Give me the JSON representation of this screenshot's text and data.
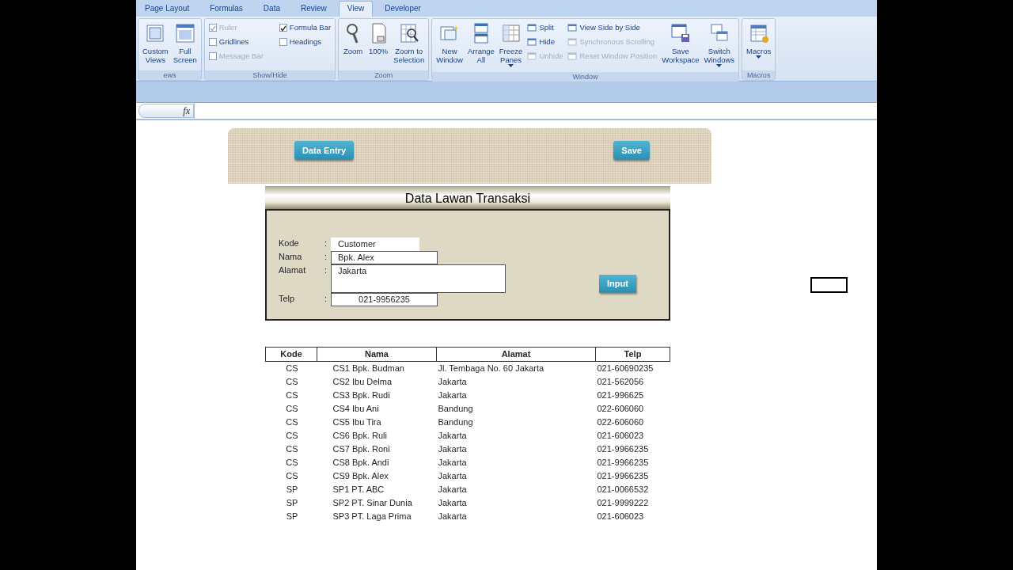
{
  "ribbon_tabs": [
    {
      "label": "Page Layout",
      "selected": false
    },
    {
      "label": "Formulas",
      "selected": false
    },
    {
      "label": "Data",
      "selected": false
    },
    {
      "label": "Review",
      "selected": false
    },
    {
      "label": "View",
      "selected": true
    },
    {
      "label": "Developer",
      "selected": false
    }
  ],
  "ribbon_groups": [
    {
      "label": "ews",
      "items": [
        {
          "kind": "large",
          "lines": [
            "Custom",
            "Views"
          ],
          "disabled": false
        },
        {
          "kind": "large",
          "lines": [
            "Full",
            "Screen"
          ],
          "disabled": false
        }
      ]
    },
    {
      "label": "Show/Hide",
      "columns": [
        [
          {
            "kind": "check",
            "label": "Ruler",
            "checked": true,
            "disabled": true
          },
          {
            "kind": "check",
            "label": "Gridlines",
            "checked": false,
            "disabled": false
          },
          {
            "kind": "check",
            "label": "Message Bar",
            "checked": false,
            "disabled": true
          }
        ],
        [
          {
            "kind": "check",
            "label": "Formula Bar",
            "checked": true,
            "disabled": false
          },
          {
            "kind": "check",
            "label": "Headings",
            "checked": false,
            "disabled": false
          }
        ]
      ]
    },
    {
      "label": "Zoom",
      "items": [
        {
          "kind": "large",
          "lines": [
            "Zoom"
          ],
          "disabled": false
        },
        {
          "kind": "large",
          "lines": [
            "100%"
          ],
          "disabled": false
        },
        {
          "kind": "large",
          "lines": [
            "Zoom to",
            "Selection"
          ],
          "disabled": false
        }
      ]
    },
    {
      "label": "Window",
      "items": [
        {
          "kind": "large",
          "lines": [
            "New",
            "Window"
          ],
          "disabled": false
        },
        {
          "kind": "large",
          "lines": [
            "Arrange",
            "All"
          ],
          "disabled": false
        },
        {
          "kind": "large",
          "lines": [
            "Freeze",
            "Panes"
          ],
          "dropdown": true,
          "disabled": false
        },
        {
          "kind": "small",
          "label": "Split",
          "disabled": false
        },
        {
          "kind": "small",
          "label": "Hide",
          "disabled": false
        },
        {
          "kind": "small",
          "label": "Unhide",
          "disabled": true
        },
        {
          "kind": "small",
          "label": "View Side by Side",
          "disabled": false
        },
        {
          "kind": "small",
          "label": "Synchronous Scrolling",
          "disabled": true
        },
        {
          "kind": "small",
          "label": "Reset Window Position",
          "disabled": true
        },
        {
          "kind": "large",
          "lines": [
            "Save",
            "Workspace"
          ],
          "disabled": false
        },
        {
          "kind": "large",
          "lines": [
            "Switch",
            "Windows"
          ],
          "dropdown": true,
          "disabled": false
        }
      ]
    },
    {
      "label": "Macros",
      "items": [
        {
          "kind": "large",
          "lines": [
            "Macros"
          ],
          "dropdown": true,
          "disabled": false
        }
      ]
    }
  ],
  "formula_bar": {
    "fx": "fx"
  },
  "banner_buttons": [
    "Data Entry",
    "Save"
  ],
  "form": {
    "title": "Data Lawan Transaksi",
    "fields": [
      {
        "label": "Kode",
        "colon": ":",
        "value": "Customer",
        "kind": "short"
      },
      {
        "label": "Nama",
        "colon": ":",
        "value": "Bpk. Alex",
        "kind": "medium"
      },
      {
        "label": "Alamat",
        "colon": ":",
        "value": "Jakarta",
        "kind": "tall"
      },
      {
        "label": "Telp",
        "colon": ":",
        "value": "021-9956235",
        "kind": "center"
      }
    ],
    "button": "Input"
  },
  "table": {
    "columns": [
      "Kode",
      "Nama",
      "Alamat",
      "Telp"
    ],
    "rows": [
      [
        "CS",
        "CS1 Bpk. Budman",
        "Jl. Tembaga No. 60 Jakarta",
        "021-60690235"
      ],
      [
        "CS",
        "CS2 Ibu Delma",
        "Jakarta",
        "021-562056"
      ],
      [
        "CS",
        "CS3 Bpk. Rudi",
        "Jakarta",
        "021-996625"
      ],
      [
        "CS",
        "CS4 Ibu Ani",
        "Bandung",
        "022-606060"
      ],
      [
        "CS",
        "CS5 Ibu Tira",
        "Bandung",
        "022-606060"
      ],
      [
        "CS",
        "CS6 Bpk. Ruli",
        "Jakarta",
        "021-606023"
      ],
      [
        "CS",
        "CS7 Bpk. Roni",
        "Jakarta",
        "021-9966235"
      ],
      [
        "CS",
        "CS8 Bpk. Andi",
        "Jakarta",
        "021-9966235"
      ],
      [
        "CS",
        "CS9 Bpk. Alex",
        "Jakarta",
        "021-9966235"
      ],
      [
        "SP",
        "SP1 PT. ABC",
        "Jakarta",
        "021-0066532"
      ],
      [
        "SP",
        "SP2 PT. Sinar Dunia",
        "Jakarta",
        "021-9999222"
      ],
      [
        "SP",
        "SP3 PT. Laga Prima",
        "Jakarta",
        "021-606023"
      ]
    ]
  }
}
